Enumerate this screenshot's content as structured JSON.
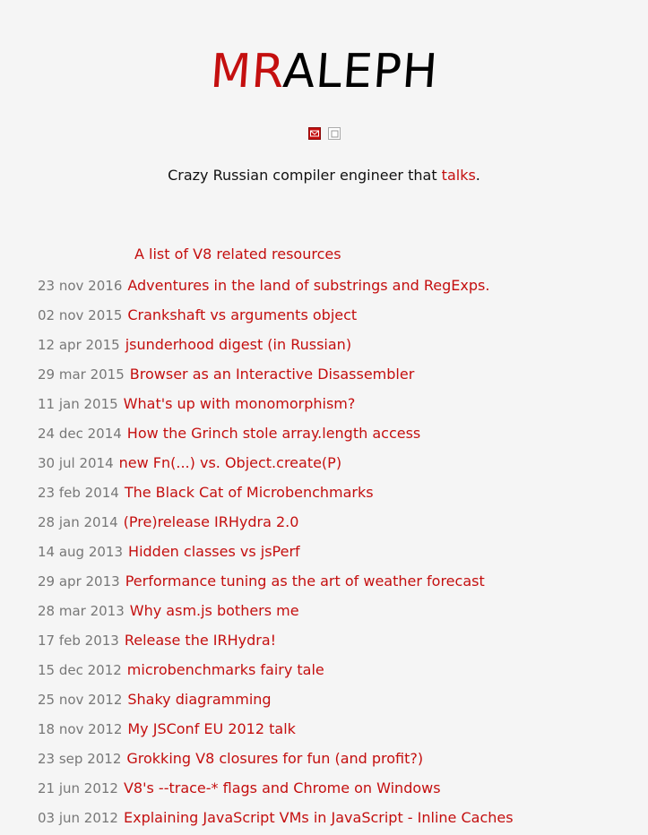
{
  "header": {
    "title_red": "MR",
    "title_black": "ALEPH"
  },
  "icons": {
    "mail": "mail-icon",
    "feed": "feed-icon"
  },
  "tagline": {
    "text": "Crazy Russian compiler engineer that ",
    "link": "talks",
    "suffix": "."
  },
  "featured": {
    "label": "A list of V8 related resources"
  },
  "posts": [
    {
      "date": "23 nov 2016",
      "title": "Adventures in the land of substrings and RegExps."
    },
    {
      "date": "02 nov 2015",
      "title": "Crankshaft vs arguments object"
    },
    {
      "date": "12 apr 2015",
      "title": "jsunderhood digest (in Russian)"
    },
    {
      "date": "29 mar 2015",
      "title": "Browser as an Interactive Disassembler"
    },
    {
      "date": "11 jan 2015",
      "title": "What's up with monomorphism?"
    },
    {
      "date": "24 dec 2014",
      "title": "How the Grinch stole array.length access"
    },
    {
      "date": "30 jul 2014",
      "title": "new Fn(...) vs. Object.create(P)"
    },
    {
      "date": "23 feb 2014",
      "title": "The Black Cat of Microbenchmarks"
    },
    {
      "date": "28 jan 2014",
      "title": "(Pre)release IRHydra 2.0"
    },
    {
      "date": "14 aug 2013",
      "title": "Hidden classes vs jsPerf"
    },
    {
      "date": "29 apr 2013",
      "title": "Performance tuning as the art of weather forecast"
    },
    {
      "date": "28 mar 2013",
      "title": "Why asm.js bothers me"
    },
    {
      "date": "17 feb 2013",
      "title": "Release the IRHydra!"
    },
    {
      "date": "15 dec 2012",
      "title": "microbenchmarks fairy tale"
    },
    {
      "date": "25 nov 2012",
      "title": "Shaky diagramming"
    },
    {
      "date": "18 nov 2012",
      "title": "My JSConf EU 2012 talk"
    },
    {
      "date": "23 sep 2012",
      "title": "Grokking V8 closures for fun (and profit?)"
    },
    {
      "date": "21 jun 2012",
      "title": "V8's --trace-* flags and Chrome on Windows"
    },
    {
      "date": "03 jun 2012",
      "title": "Explaining JavaScript VMs in JavaScript - Inline Caches"
    }
  ]
}
